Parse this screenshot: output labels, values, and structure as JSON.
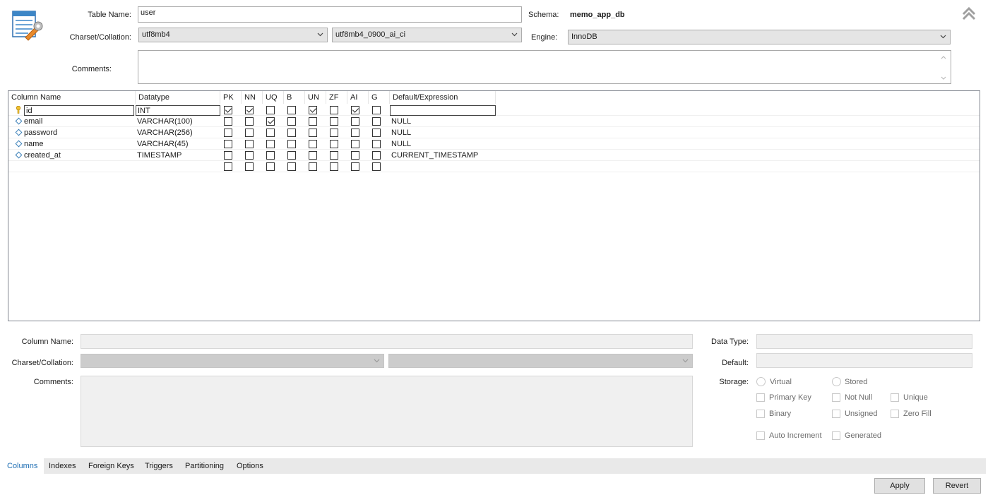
{
  "header": {
    "table_name_label": "Table Name:",
    "table_name_value": "user",
    "schema_label": "Schema:",
    "schema_value": "memo_app_db",
    "charset_label": "Charset/Collation:",
    "charset_value": "utf8mb4",
    "collation_value": "utf8mb4_0900_ai_ci",
    "engine_label": "Engine:",
    "engine_value": "InnoDB",
    "comments_label": "Comments:",
    "comments_value": ""
  },
  "grid": {
    "headers": [
      "Column Name",
      "Datatype",
      "PK",
      "NN",
      "UQ",
      "B",
      "UN",
      "ZF",
      "AI",
      "G",
      "Default/Expression"
    ],
    "rows": [
      {
        "name": "id",
        "datatype": "INT",
        "flags": [
          true,
          true,
          false,
          false,
          true,
          false,
          true,
          false
        ],
        "default": "",
        "icon": "key-icon"
      },
      {
        "name": "email",
        "datatype": "VARCHAR(100)",
        "flags": [
          false,
          false,
          true,
          false,
          false,
          false,
          false,
          false
        ],
        "default": "NULL",
        "icon": "diamond-icon"
      },
      {
        "name": "password",
        "datatype": "VARCHAR(256)",
        "flags": [
          false,
          false,
          false,
          false,
          false,
          false,
          false,
          false
        ],
        "default": "NULL",
        "icon": "diamond-icon"
      },
      {
        "name": "name",
        "datatype": "VARCHAR(45)",
        "flags": [
          false,
          false,
          false,
          false,
          false,
          false,
          false,
          false
        ],
        "default": "NULL",
        "icon": "diamond-icon"
      },
      {
        "name": "created_at",
        "datatype": "TIMESTAMP",
        "flags": [
          false,
          false,
          false,
          false,
          false,
          false,
          false,
          false
        ],
        "default": "CURRENT_TIMESTAMP",
        "icon": "diamond-icon"
      },
      {
        "name": "",
        "datatype": "",
        "flags": [
          false,
          false,
          false,
          false,
          false,
          false,
          false,
          false
        ],
        "default": "",
        "icon": ""
      }
    ]
  },
  "detail": {
    "column_name_label": "Column Name:",
    "charset_label": "Charset/Collation:",
    "comments_label": "Comments:",
    "data_type_label": "Data Type:",
    "default_label": "Default:",
    "storage_label": "Storage:",
    "virtual": "Virtual",
    "stored": "Stored",
    "primary_key": "Primary Key",
    "not_null": "Not Null",
    "unique": "Unique",
    "binary": "Binary",
    "unsigned": "Unsigned",
    "zero_fill": "Zero Fill",
    "auto_increment": "Auto Increment",
    "generated": "Generated"
  },
  "tabs": [
    "Columns",
    "Indexes",
    "Foreign Keys",
    "Triggers",
    "Partitioning",
    "Options"
  ],
  "buttons": {
    "apply": "Apply",
    "revert": "Revert"
  },
  "colors": {
    "accent": "#1f6fb4",
    "checkbox_border": "#333333",
    "tabbar": "#e9e9e9"
  }
}
